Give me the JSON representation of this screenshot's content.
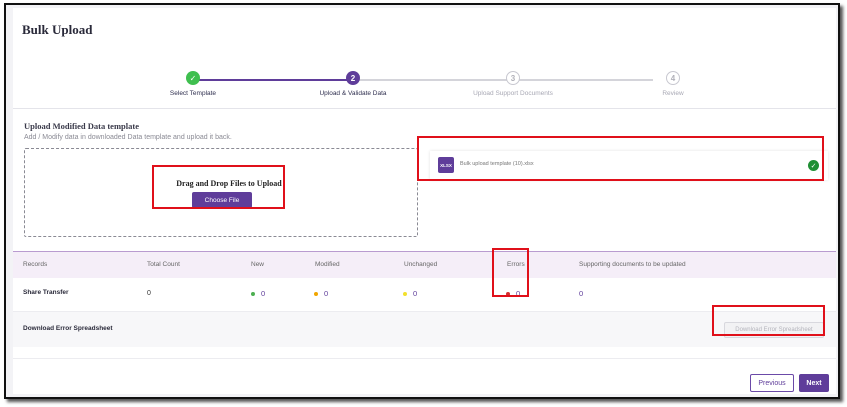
{
  "page": {
    "title": "Bulk Upload"
  },
  "stepper": {
    "steps": [
      {
        "number": "1",
        "label": "Select Template",
        "state": "done"
      },
      {
        "number": "2",
        "label": "Upload & Validate Data",
        "state": "active"
      },
      {
        "number": "3",
        "label": "Upload Support Documents",
        "state": "todo"
      },
      {
        "number": "4",
        "label": "Review",
        "state": "todo"
      }
    ]
  },
  "upload": {
    "title": "Upload Modified Data template",
    "subtitle": "Add / Modify data in downloaded Data template and upload it back.",
    "drop_text": "Drag and Drop Files to Upload",
    "choose_file_label": "Choose File"
  },
  "file": {
    "badge": "XLSX",
    "name": "Bulk upload template (10).xlsx",
    "status_icon": "check-circle-icon"
  },
  "table": {
    "headers": [
      "Records",
      "Total Count",
      "New",
      "Modified",
      "Unchanged",
      "Errors",
      "Supporting documents to be updated"
    ],
    "row": {
      "record": "Share Transfer",
      "total": "0",
      "new": "0",
      "modified": "0",
      "unchanged": "0",
      "errors": "0",
      "supporting": "0"
    }
  },
  "download": {
    "label": "Download Error Spreadsheet",
    "button_label": "Download Error Spreadsheet"
  },
  "nav": {
    "previous": "Previous",
    "next": "Next"
  },
  "colors": {
    "accent": "#5f3d9a",
    "done": "#3fbf4f",
    "new_dot": "#4caf50",
    "modified_dot": "#f0a500",
    "unchanged_dot": "#f2e02c",
    "error_dot": "#d32f2f",
    "highlight": "#e0101a"
  }
}
